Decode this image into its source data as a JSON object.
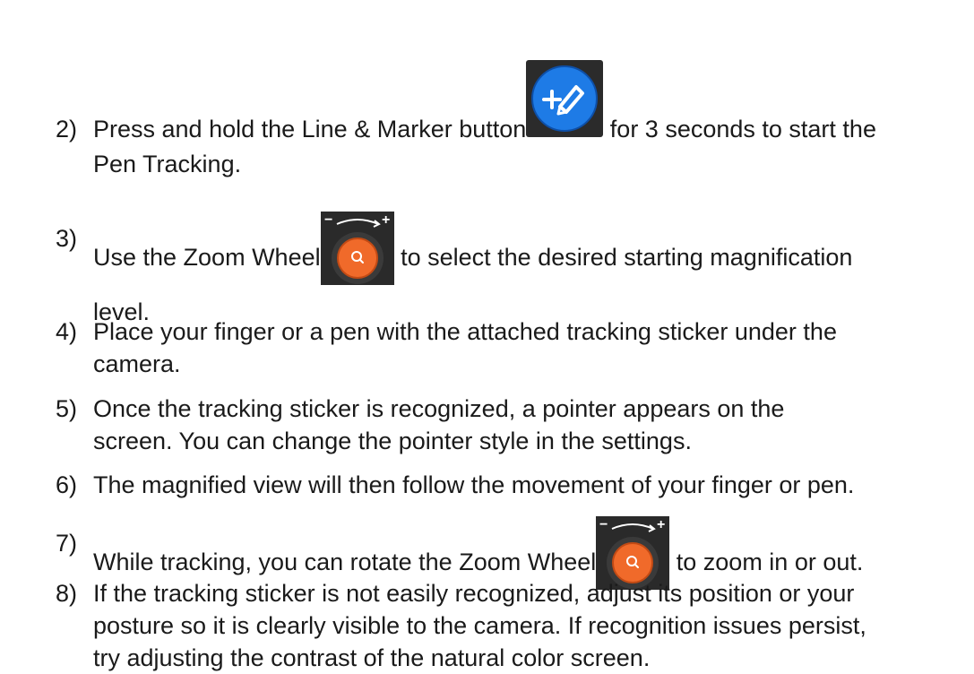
{
  "steps": [
    {
      "number": "2)",
      "before_icon": "Press and hold the Line & Marker button",
      "icon": "line-marker-button-icon",
      "after_icon": " for 3 seconds to start the",
      "line2": "Pen Tracking."
    },
    {
      "number": "3)",
      "before_icon": "Use the Zoom Wheel",
      "icon": "zoom-wheel-icon",
      "after_icon": " to select the desired starting magnification",
      "line2": "level."
    },
    {
      "number": "4)",
      "line1": "Place your finger or a pen with the attached tracking sticker under the",
      "line2": "camera."
    },
    {
      "number": "5)",
      "line1": "Once the tracking sticker is recognized, a pointer appears on the",
      "line2": "screen. You can change the pointer style in the settings."
    },
    {
      "number": "6)",
      "line1": "The magnified view will then follow the movement of your finger or pen."
    },
    {
      "number": "7)",
      "before_icon": "While tracking, you can rotate the Zoom Wheel",
      "icon": "zoom-wheel-icon",
      "after_icon": " to zoom in or out."
    },
    {
      "number": "8)",
      "line1": "If the tracking sticker is not easily recognized, adjust its position or your",
      "line2": "posture so it is clearly visible to the camera. If recognition issues persist,",
      "line3": "try adjusting the contrast of the natural color screen."
    }
  ],
  "colors": {
    "text": "#1a1a1a",
    "marker_button_blue": "#1e7be6",
    "zoom_wheel_orange": "#f06a2a",
    "icon_background": "#2b2b2b"
  }
}
